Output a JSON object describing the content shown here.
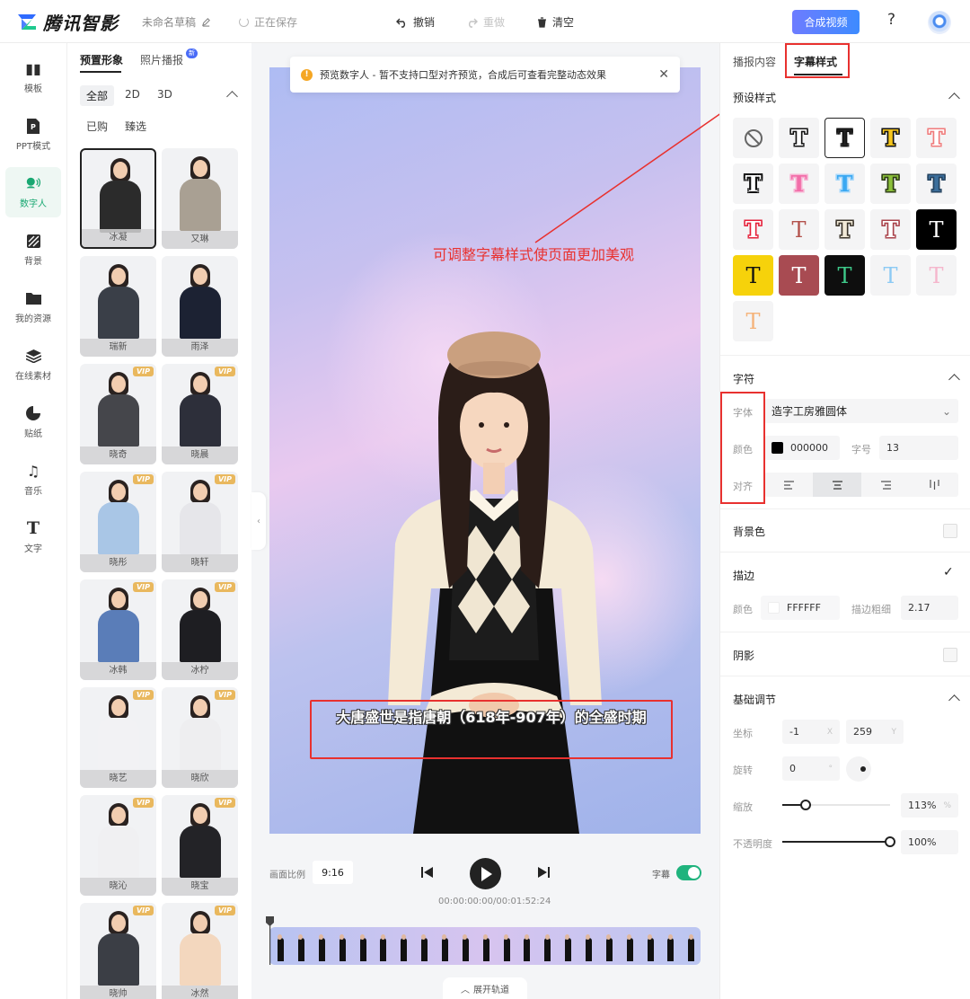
{
  "topbar": {
    "logo_text": "腾讯智影",
    "draft_name": "未命名草稿",
    "save_status": "正在保存",
    "undo_label": "撤销",
    "redo_label": "重做",
    "clear_label": "清空",
    "compose_label": "合成视频",
    "help_label": "?"
  },
  "leftnav": {
    "items": [
      {
        "label": "模板",
        "icon": "template-icon"
      },
      {
        "label": "PPT模式",
        "icon": "ppt-icon"
      },
      {
        "label": "数字人",
        "icon": "digital-human-icon",
        "active": true
      },
      {
        "label": "背景",
        "icon": "background-icon"
      },
      {
        "label": "我的资源",
        "icon": "folder-icon"
      },
      {
        "label": "在线素材",
        "icon": "layers-icon"
      },
      {
        "label": "贴纸",
        "icon": "sticker-icon"
      },
      {
        "label": "音乐",
        "icon": "music-icon"
      },
      {
        "label": "文字",
        "icon": "text-icon"
      }
    ]
  },
  "avatar_panel": {
    "tabs": [
      "预置形象",
      "照片播报"
    ],
    "new_badge": "新",
    "filters": [
      "全部",
      "2D",
      "3D"
    ],
    "subfilters": [
      "已购",
      "臻选"
    ],
    "avatars": [
      {
        "name": "冰凝",
        "vip": false,
        "outfit": "#2b2b2b"
      },
      {
        "name": "又琳",
        "vip": false,
        "outfit": "#a9a093"
      },
      {
        "name": "瑞新",
        "vip": false,
        "outfit": "#3a3f48"
      },
      {
        "name": "雨泽",
        "vip": false,
        "outfit": "#1c2233"
      },
      {
        "name": "晓奇",
        "vip": true,
        "outfit": "#45464b"
      },
      {
        "name": "晓晨",
        "vip": true,
        "outfit": "#2d2f3a"
      },
      {
        "name": "晓彤",
        "vip": true,
        "outfit": "#a9c6e6"
      },
      {
        "name": "晓轩",
        "vip": true,
        "outfit": "#e6e6ea"
      },
      {
        "name": "冰韩",
        "vip": true,
        "outfit": "#5a7db8"
      },
      {
        "name": "冰柠",
        "vip": true,
        "outfit": "#1e1e22"
      },
      {
        "name": "晓艺",
        "vip": true,
        "outfit": "#f2f2f4"
      },
      {
        "name": "晓欣",
        "vip": true,
        "outfit": "#eeeef0"
      },
      {
        "name": "晓沁",
        "vip": true,
        "outfit": "#f0f0f2"
      },
      {
        "name": "晓宝",
        "vip": true,
        "outfit": "#232327"
      },
      {
        "name": "晓帅",
        "vip": true,
        "outfit": "#3b3e45"
      },
      {
        "name": "冰然",
        "vip": true,
        "outfit": "#f3d7be"
      }
    ],
    "vip_label": "VIP"
  },
  "preview": {
    "notice_text": "预览数字人 - 暂不支持口型对齐预览，合成后可查看完整动态效果",
    "annotation": "可调整字幕样式使页面更加美观",
    "subtitle_text": "大唐盛世是指唐朝（618年-907年）的全盛时期"
  },
  "player": {
    "ratio_label": "画面比例",
    "ratio_value": "9:16",
    "subtitle_toggle_label": "字幕",
    "subtitle_on": true,
    "time": "00:00:00:00/00:01:52:24",
    "expand_label": "展开轨道"
  },
  "rightpanel": {
    "tabs": [
      "播报内容",
      "字幕样式"
    ],
    "preset_title": "预设样式",
    "presets": [
      {
        "kind": "none"
      },
      {
        "fill": "#ffffff",
        "stroke": "#111111"
      },
      {
        "fill": "#ffffff",
        "stroke": "#111111",
        "selected": true,
        "plain": true
      },
      {
        "fill": "#f5c51c",
        "stroke": "#111111"
      },
      {
        "fill": "#ffffff",
        "stroke": "#f07a7a"
      },
      {
        "fill": "#ffffff",
        "stroke": "#111111",
        "heavy": true
      },
      {
        "fill": "#f26da8",
        "stroke": "#f7b3d3"
      },
      {
        "fill": "#3aa8f2",
        "stroke": "#a8d8fa"
      },
      {
        "fill": "#8bbf3a",
        "stroke": "#2b3b14"
      },
      {
        "fill": "#3c6f9c",
        "stroke": "#24425e"
      },
      {
        "fill": "#ffffff",
        "stroke": "#e5203a"
      },
      {
        "fill": "#b3524c",
        "stroke": "none",
        "plain": true
      },
      {
        "fill": "#f2ead8",
        "stroke": "#3b342a"
      },
      {
        "fill": "#ffffff",
        "stroke": "#a9424a"
      },
      {
        "fill": "#ffffff",
        "stroke": "none",
        "bg": "#000000",
        "plain": true
      },
      {
        "fill": "#111111",
        "stroke": "none",
        "bg": "#f6d20b",
        "plain": true
      },
      {
        "fill": "#ffffff",
        "stroke": "none",
        "bg": "#a84b52",
        "plain": true
      },
      {
        "fill": "#3ec98a",
        "stroke": "none",
        "bg": "#0e0e0e",
        "plain": true
      },
      {
        "fill": "#8ccaf4",
        "stroke": "none",
        "plain": true,
        "light": true
      },
      {
        "fill": "#f5b6cc",
        "stroke": "none",
        "plain": true,
        "light": true
      },
      {
        "fill": "#f5b37a",
        "stroke": "none",
        "plain": true,
        "light": true
      }
    ],
    "preset_glyph": "T",
    "char_title": "字符",
    "font_label": "字体",
    "font_value": "造字工房雅圆体",
    "color_label": "颜色",
    "color_value": "000000",
    "color_swatch": "#000000",
    "size_label": "字号",
    "size_value": "13",
    "align_label": "对齐",
    "align_options": [
      "left",
      "center",
      "right",
      "vertical"
    ],
    "align_selected": "center",
    "bg_color_title": "背景色",
    "stroke_title": "描边",
    "stroke_on": true,
    "stroke_color_label": "颜色",
    "stroke_color_value": "FFFFFF",
    "stroke_width_label": "描边粗细",
    "stroke_width_value": "2.17",
    "shadow_title": "阴影",
    "basic_title": "基础调节",
    "coord_label": "坐标",
    "coord_x": "-1",
    "coord_x_unit": "X",
    "coord_y": "259",
    "coord_y_unit": "Y",
    "rotate_label": "旋转",
    "rotate_value": "0",
    "rotate_unit": "°",
    "scale_label": "缩放",
    "scale_value": "113%",
    "scale_unit": "%",
    "scale_level": 0.22,
    "opacity_label": "不透明度",
    "opacity_value": "100%",
    "opacity_level": 1.0
  }
}
